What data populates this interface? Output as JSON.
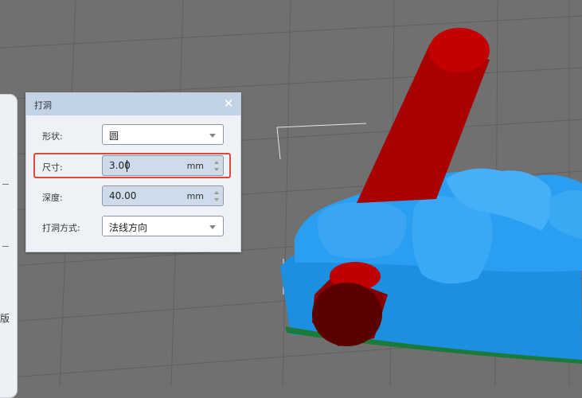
{
  "dialog": {
    "title": "打洞",
    "close_glyph": "✕",
    "fields": [
      {
        "label": "形状:",
        "value": "圆",
        "type": "select"
      },
      {
        "label": "尺寸:",
        "value": "3.00",
        "unit": "mm",
        "type": "number"
      },
      {
        "label": "深度:",
        "value": "40.00",
        "unit": "mm",
        "type": "number"
      },
      {
        "label": "打洞方式:",
        "value": "法线方向",
        "type": "select"
      }
    ]
  },
  "side_panel": {
    "text": "版"
  },
  "colors": {
    "viewport_bg": "#707070",
    "grid": "#5f5f5f",
    "model_blue": "#1a8fe0",
    "drill_red": "#b10000",
    "dialog_header": "#c2d3e6",
    "highlight": "#e0453b"
  },
  "icons": [
    "close-icon",
    "chevron-down-icon",
    "spin-up-icon",
    "spin-down-icon"
  ]
}
